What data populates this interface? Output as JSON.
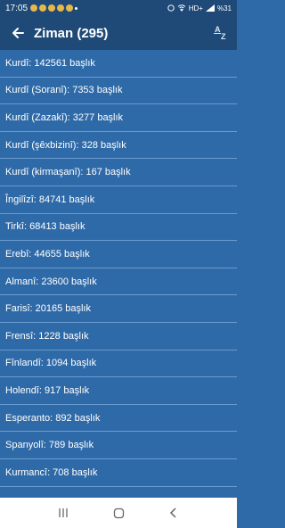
{
  "status": {
    "time": "17:05",
    "battery": "%31",
    "network": "HD+"
  },
  "header": {
    "title": "Ziman (295)",
    "sort_a": "A",
    "sort_z": "Z"
  },
  "rows": [
    "Kurdî: 142561 başlık",
    "Kurdî (Soranî): 7353 başlık",
    "Kurdî (Zazakî): 3277 başlık",
    "Kurdî (şêxbizinî): 328 başlık",
    "Kurdî (kirmaşanî): 167 başlık",
    "Îngilîzî: 84741 başlık",
    "Tirkî: 68413 başlık",
    "Erebî: 44655 başlık",
    "Almanî: 23600 başlık",
    "Farisî: 20165 başlık",
    "Frensî: 1228 başlık",
    "Fînlandî: 1094 başlık",
    "Holendî: 917 başlık",
    "Esperanto: 892 başlık",
    "Spanyolî: 789 başlık",
    "Kurmancî: 708 başlık"
  ]
}
